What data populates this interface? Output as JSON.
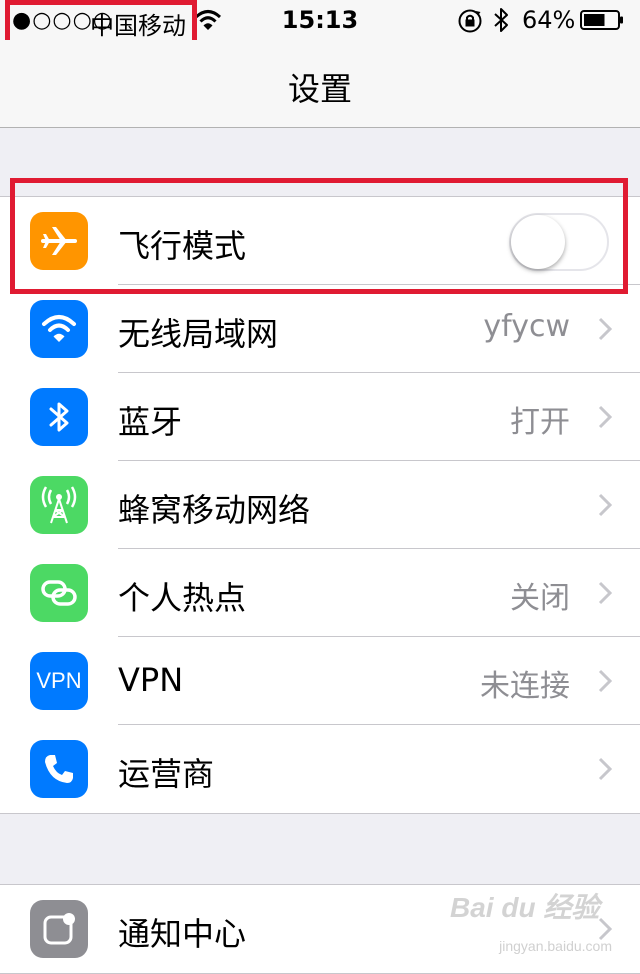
{
  "status_bar": {
    "signal": "●○○○○",
    "carrier": "中国移动",
    "time": "15:13",
    "battery_pct": "64%",
    "battery_level": 0.64
  },
  "nav": {
    "title": "设置"
  },
  "group1": {
    "airplane": {
      "label": "飞行模式",
      "icon": "airplane-icon",
      "color": "#ff9500",
      "toggle_on": false
    },
    "wifi": {
      "label": "无线局域网",
      "value": "yfycw",
      "icon": "wifi-icon",
      "color": "#007aff"
    },
    "bluetooth": {
      "label": "蓝牙",
      "value": "打开",
      "icon": "bluetooth-icon",
      "color": "#007aff"
    },
    "cellular": {
      "label": "蜂窝移动网络",
      "value": "",
      "icon": "cellular-antenna-icon",
      "color": "#4cd964"
    },
    "hotspot": {
      "label": "个人热点",
      "value": "关闭",
      "icon": "hotspot-link-icon",
      "color": "#4cd964"
    },
    "vpn": {
      "label": "VPN",
      "value": "未连接",
      "icon_text": "VPN",
      "color": "#007aff"
    },
    "carrier": {
      "label": "运营商",
      "value": "",
      "icon": "phone-icon",
      "color": "#007aff"
    }
  },
  "group2": {
    "notifications": {
      "label": "通知中心",
      "icon": "notification-center-icon",
      "color": "#8e8e93"
    }
  },
  "watermark": {
    "brand": "Bai du 经验",
    "sub": "jingyan.baidu.com"
  },
  "annotation_color": "#e01b32"
}
